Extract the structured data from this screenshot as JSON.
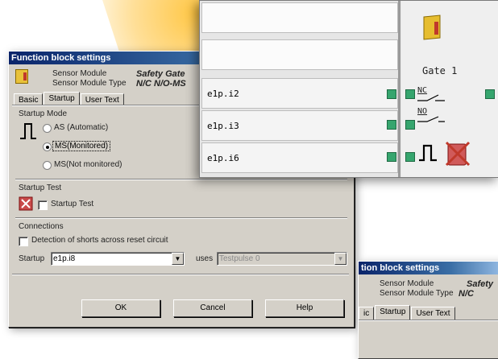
{
  "main_dialog": {
    "title": "Function block settings",
    "sensor_module_label": "Sensor Module",
    "sensor_module_value": "Safety Gate",
    "sensor_type_label": "Sensor Module Type",
    "sensor_type_value": "N/C N/O-MS",
    "tabs": [
      "Basic",
      "Startup",
      "User Text"
    ],
    "active_tab": "Startup",
    "startup_mode_label": "Startup Mode",
    "radio_options": [
      "AS (Automatic)",
      "MS(Monitored)",
      "MS(Not monitored)"
    ],
    "selected_option": "MS(Monitored)",
    "startup_test_label": "Startup Test",
    "startup_test_checkbox": "Startup Test",
    "connections_label": "Connections",
    "shorts_checkbox": "Detection of shorts across reset circuit",
    "startup_field_label": "Startup",
    "startup_field_value": "e1p.i8",
    "uses_label": "uses",
    "uses_value": "Testpulse 0",
    "buttons": {
      "ok": "OK",
      "cancel": "Cancel",
      "help": "Help"
    }
  },
  "editor": {
    "signals": [
      "",
      "",
      "e1p.i2",
      "e1p.i3",
      "e1p.i6"
    ],
    "block_name": "Gate 1",
    "contact_nc": "NC",
    "contact_no": "NO",
    "pin_color": "#36a56e"
  },
  "second_dialog": {
    "title": "tion block settings",
    "sensor_module_label": "Sensor Module",
    "sensor_module_value": "Safety",
    "sensor_type_label": "Sensor Module Type",
    "sensor_type_value": "N/C",
    "tabs": [
      "ic",
      "Startup",
      "User Text"
    ]
  }
}
